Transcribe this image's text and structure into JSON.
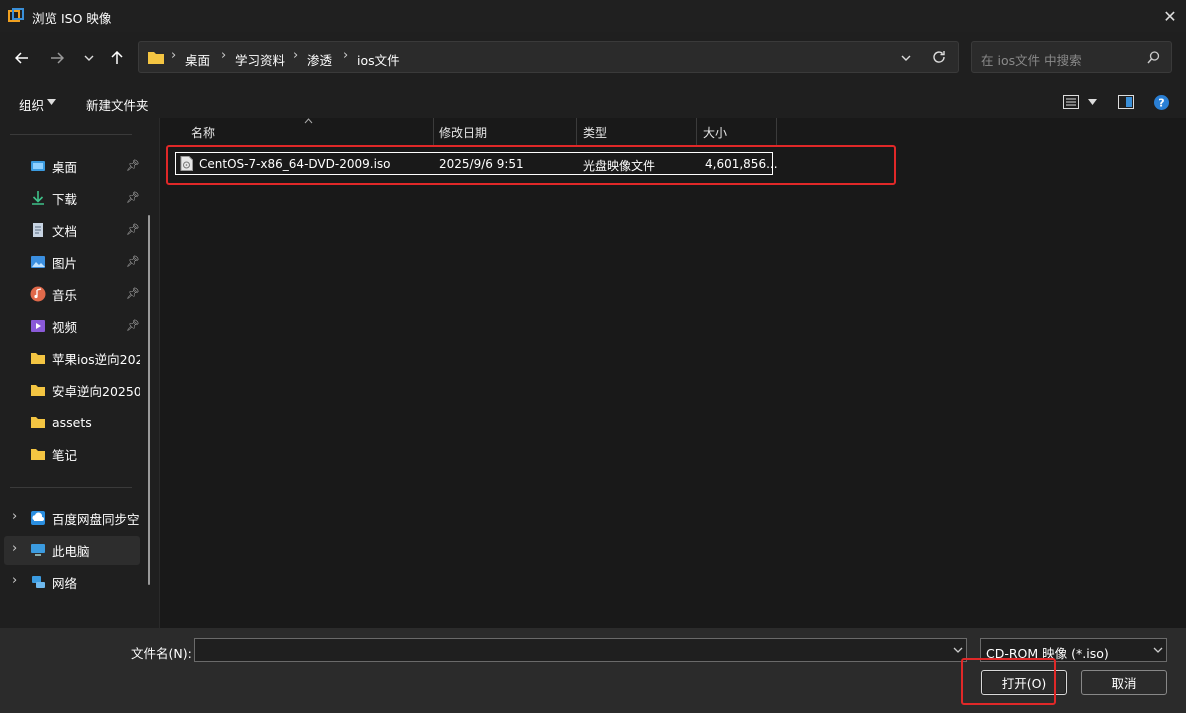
{
  "window": {
    "title": "浏览 ISO 映像"
  },
  "nav": {
    "back": "←",
    "forward": "→",
    "recent": "⌄",
    "up": "↑"
  },
  "breadcrumb": [
    "桌面",
    "学习资料",
    "渗透",
    "ios文件"
  ],
  "search": {
    "placeholder": "在 ios文件 中搜索"
  },
  "toolbar": {
    "organize": "组织",
    "new_folder": "新建文件夹"
  },
  "sidebar": {
    "quick_access": [
      {
        "label": "桌面",
        "icon": "desktop-icon",
        "pinned": true
      },
      {
        "label": "下载",
        "icon": "download-icon",
        "pinned": true
      },
      {
        "label": "文档",
        "icon": "document-icon",
        "pinned": true
      },
      {
        "label": "图片",
        "icon": "pictures-icon",
        "pinned": true
      },
      {
        "label": "音乐",
        "icon": "music-icon",
        "pinned": true
      },
      {
        "label": "视频",
        "icon": "video-icon",
        "pinned": true
      },
      {
        "label": "苹果ios逆向202",
        "icon": "folder-icon",
        "pinned": false
      },
      {
        "label": "安卓逆向20250",
        "icon": "folder-icon",
        "pinned": false
      },
      {
        "label": "assets",
        "icon": "folder-icon",
        "pinned": false
      },
      {
        "label": "笔记",
        "icon": "folder-icon",
        "pinned": false
      }
    ],
    "locations": [
      {
        "label": "百度网盘同步空",
        "icon": "cloud-sync-icon"
      },
      {
        "label": "此电脑",
        "icon": "computer-icon"
      },
      {
        "label": "网络",
        "icon": "network-icon"
      }
    ]
  },
  "columns": [
    "名称",
    "修改日期",
    "类型",
    "大小"
  ],
  "files": [
    {
      "name": "CentOS-7-x86_64-DVD-2009.iso",
      "modified": "2025/9/6 9:51",
      "type": "光盘映像文件",
      "size": "4,601,856..."
    }
  ],
  "bottom": {
    "filename_label": "文件名(N):",
    "filename_value": "",
    "filetype": "CD-ROM 映像 (*.iso)",
    "open_label": "打开(O)",
    "cancel_label": "取消"
  },
  "colors": {
    "highlight_box": "#e02828",
    "background": "#1f1f1f"
  }
}
